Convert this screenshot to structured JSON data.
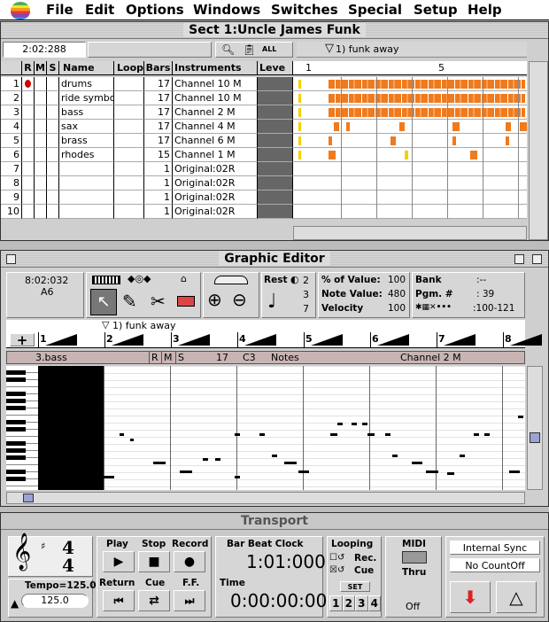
{
  "menubar": {
    "items": [
      "File",
      "Edit",
      "Options",
      "Windows",
      "Switches",
      "Special",
      "Setup",
      "Help"
    ]
  },
  "tracks_window": {
    "title": "Sect 1:Uncle James Funk",
    "time": "2:02:288",
    "all_label": "ALL",
    "marker": "1) funk away",
    "ruler": [
      "1",
      "5"
    ],
    "headers": {
      "rec": "R",
      "mute": "M",
      "solo": "S",
      "name": "Name",
      "loop": "Loop",
      "bars": "Bars",
      "instruments": "Instruments",
      "level": "Leve"
    },
    "rows": [
      {
        "num": "1",
        "name": "drums",
        "bars": "17",
        "instrument": "Channel 10 M"
      },
      {
        "num": "2",
        "name": "ride symbol",
        "bars": "17",
        "instrument": "Channel 10 M"
      },
      {
        "num": "3",
        "name": "bass",
        "bars": "17",
        "instrument": "Channel 2 M"
      },
      {
        "num": "4",
        "name": "sax",
        "bars": "17",
        "instrument": "Channel 4 M"
      },
      {
        "num": "5",
        "name": "brass",
        "bars": "17",
        "instrument": "Channel 6 M"
      },
      {
        "num": "6",
        "name": "rhodes",
        "bars": "15",
        "instrument": "Channel 1 M"
      },
      {
        "num": "7",
        "name": "",
        "bars": "1",
        "instrument": "Original:02R"
      },
      {
        "num": "8",
        "name": "",
        "bars": "1",
        "instrument": "Original:02R"
      },
      {
        "num": "9",
        "name": "",
        "bars": "1",
        "instrument": "Original:02R"
      },
      {
        "num": "10",
        "name": "",
        "bars": "1",
        "instrument": "Original:02R"
      }
    ]
  },
  "graphic_editor": {
    "title": "Graphic Editor",
    "time": "8:02:032",
    "pitch": "A6",
    "rest_label": "Rest",
    "tuplet": "2",
    "tuplet2": "3",
    "tuplet3": "7",
    "pct_label": "% of Value:",
    "pct_value": "100",
    "note_label": "Note Value:",
    "note_value": "480",
    "vel_label": "Velocity",
    "vel_value": "100",
    "bank_label": "Bank",
    "bank_value": ":--",
    "pgm_label": "Pgm. #",
    "pgm_value": ": 39",
    "range_value": ":100-121",
    "marker": "1) funk away",
    "bars": [
      "1",
      "2",
      "3",
      "4",
      "5",
      "6",
      "7",
      "8"
    ],
    "track_name": "3.bass",
    "track_r": "R",
    "track_m": "M",
    "track_s": "S",
    "track_bars": "17",
    "track_pitch": "C3",
    "track_notes": "Notes",
    "track_channel": "Channel 2 M"
  },
  "transport": {
    "title": "Transport",
    "time_sig_top": "4",
    "time_sig_bottom": "4",
    "tempo_label": "Tempo=125.0",
    "tempo_value": "125.0",
    "play": "Play",
    "stop": "Stop",
    "record": "Record",
    "return": "Return",
    "cue": "Cue",
    "ff": "F.F.",
    "bbc_label": "Bar Beat Clock",
    "bbc_value": "1:01:000",
    "time_label": "Time",
    "time_value": "0:00:00:00",
    "looping": "Looping",
    "rec": "Rec.",
    "cue2": "Cue",
    "set": "SET",
    "set_nums": [
      "1",
      "2",
      "3",
      "4"
    ],
    "midi": "MIDI",
    "thru": "Thru",
    "off": "Off",
    "internal_sync": "Internal Sync",
    "countoff": "No CountOff"
  }
}
